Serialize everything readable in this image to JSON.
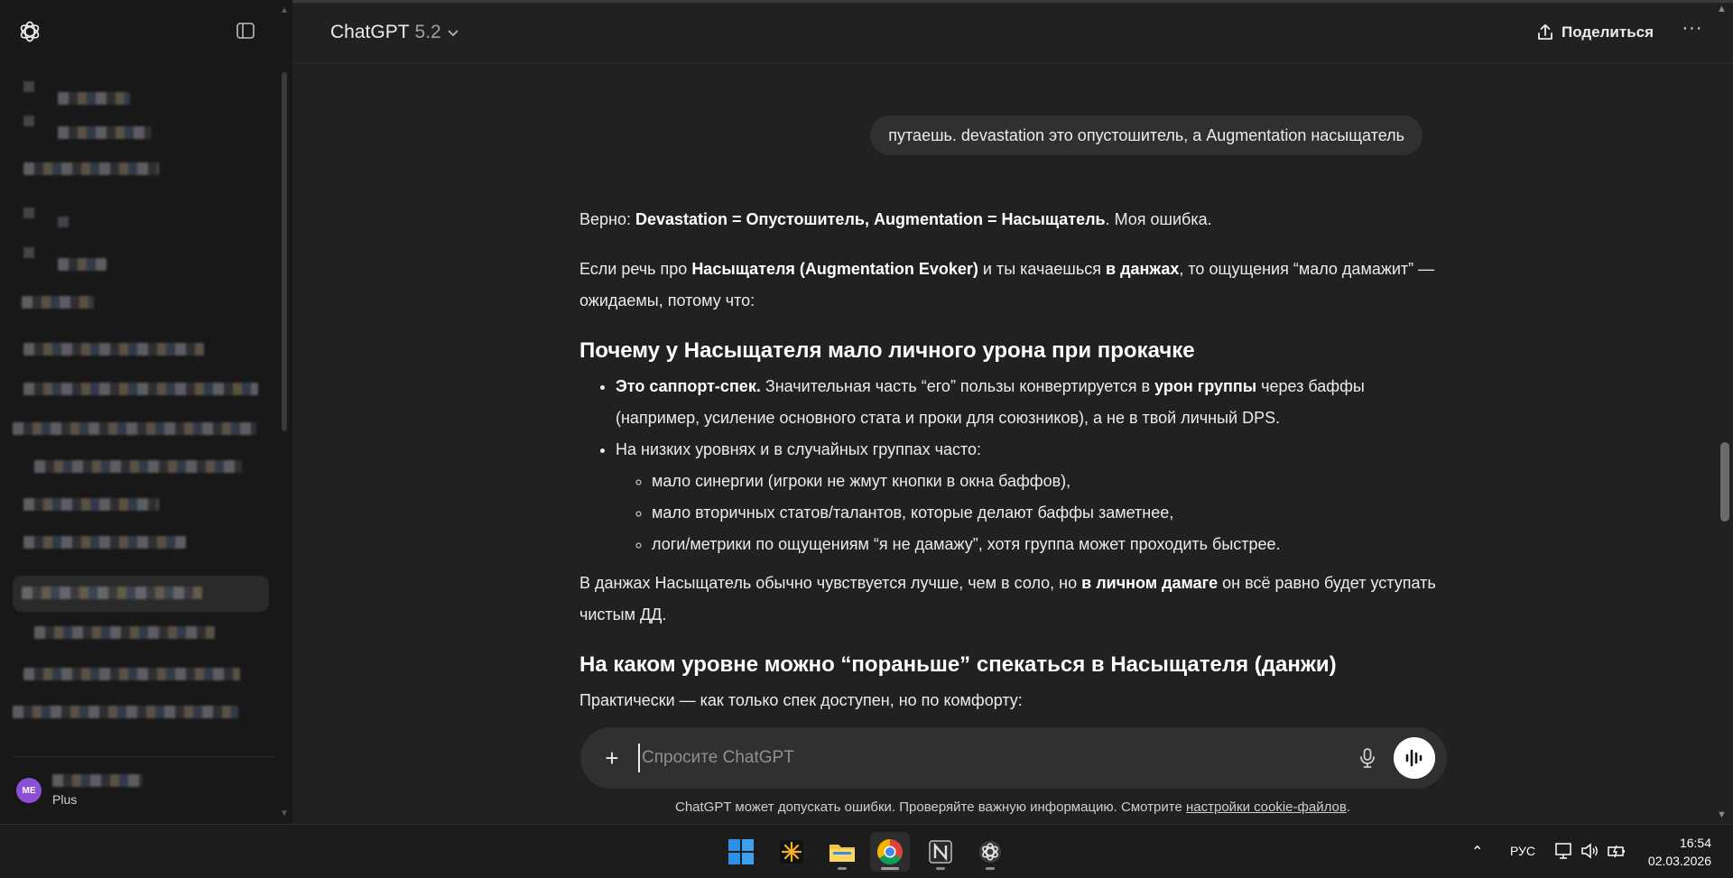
{
  "header": {
    "model_name": "ChatGPT",
    "model_version": "5.2",
    "share_label": "Поделиться",
    "more_label": "···"
  },
  "sidebar": {
    "user": {
      "initials": "ME",
      "plan": "Plus"
    }
  },
  "conversation": {
    "user_message": "путаешь. devastation это опустошитель, а Augmentation насыщатель",
    "answer": {
      "p1_a": "Верно: ",
      "p1_b": "Devastation = Опустошитель, Augmentation = Насыщатель",
      "p1_c": ". Моя ошибка.",
      "p2_a": "Если речь про ",
      "p2_b": "Насыщателя (Augmentation Evoker)",
      "p2_c": " и ты качаешься ",
      "p2_d": "в данжах",
      "p2_e": ", то ощущения “мало дамажит” — ожидаемы, потому что:",
      "h1": "Почему у Насыщателя мало личного урона при прокачке",
      "li1_a": "Это саппорт-спек.",
      "li1_b": " Значительная часть “его” пользы конвертируется в ",
      "li1_c": "урон группы",
      "li1_d": " через баффы (например, усиление основного стата и проки для союзников), а не в твой личный DPS.",
      "li2": "На низких уровнях и в случайных группах часто:",
      "sub1": "мало синергии (игроки не жмут кнопки в окна баффов),",
      "sub2": "мало вторичных статов/талантов, которые делают баффы заметнее,",
      "sub3": "логи/метрики по ощущениям “я не дамажу”, хотя группа может проходить быстрее.",
      "p3_a": "В данжах Насыщатель обычно чувствуется лучше, чем в соло, но ",
      "p3_b": "в личном дамаге",
      "p3_c": " он всё равно будет уступать чистым ДД.",
      "h2": "На каком уровне можно “пораньше” спекаться в Насыщателя (данжи)",
      "p4": "Практически — как только спек доступен, но по комфорту:"
    }
  },
  "composer": {
    "placeholder": "Спросите ChatGPT"
  },
  "disclaimer": {
    "text": "ChatGPT может допускать ошибки. Проверяйте важную информацию. Смотрите ",
    "link": "настройки cookie-файлов",
    "end": "."
  },
  "taskbar": {
    "apps": [
      "windows-start",
      "spark-app",
      "file-explorer",
      "chrome",
      "notion",
      "chatgpt-app"
    ],
    "language": "РУС",
    "time": "16:54",
    "date": "02.03.2026"
  }
}
